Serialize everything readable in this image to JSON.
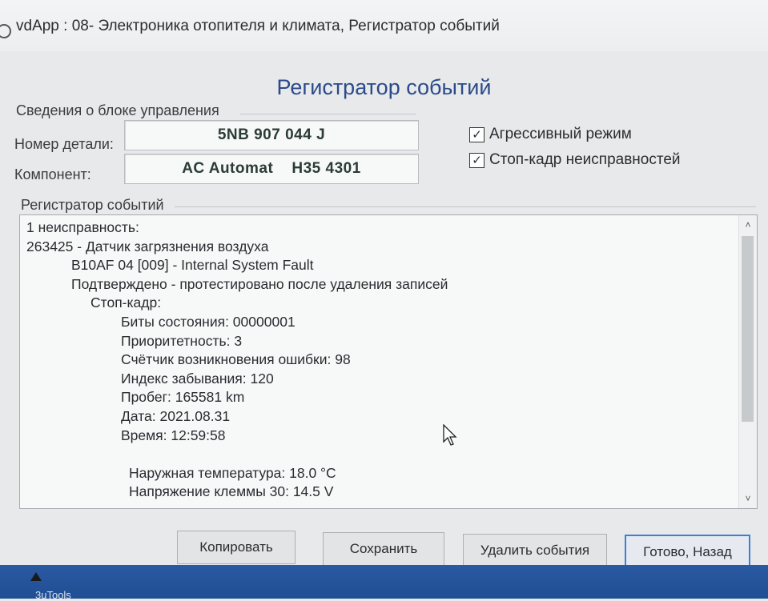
{
  "window": {
    "title": "vdApp : 08- Электроника отопителя и климата,  Регистратор событий"
  },
  "heading": "Регистратор событий",
  "module_info": {
    "section_label": "Сведения о блоке управления",
    "part_number_label": "Номер детали:",
    "part_number_value": "5NB 907 044 J",
    "component_label": "Компонент:",
    "component_value": "AC Automat    H35 4301"
  },
  "options": {
    "aggressive_mode": {
      "label": "Агрессивный режим",
      "checked": true
    },
    "freeze_frame": {
      "label": "Стоп-кадр неисправностей",
      "checked": true
    }
  },
  "event_log": {
    "section_label": "Регистратор событий",
    "lines": [
      {
        "indent": 0,
        "text": "1 неисправность:"
      },
      {
        "indent": 0,
        "text": "263425 - Датчик загрязнения воздуха"
      },
      {
        "indent": 1,
        "text": "B10AF 04 [009] - Internal System Fault"
      },
      {
        "indent": 1,
        "text": "Подтверждено - протестировано после удаления записей"
      },
      {
        "indent": 2,
        "text": "Стоп-кадр:"
      },
      {
        "indent": 3,
        "text": "Биты состояния: 00000001"
      },
      {
        "indent": 3,
        "text": "Приоритетность: 3"
      },
      {
        "indent": 3,
        "text": "Счётчик возникновения ошибки: 98"
      },
      {
        "indent": 3,
        "text": "Индекс забывания: 120"
      },
      {
        "indent": 3,
        "text": "Пробег: 165581 km"
      },
      {
        "indent": 3,
        "text": "Дата: 2021.08.31"
      },
      {
        "indent": 3,
        "text": "Время: 12:59:58"
      },
      {
        "indent": 3,
        "text": ""
      },
      {
        "indent": 3,
        "text": "Наружная температура: 18.0 °C"
      },
      {
        "indent": 3,
        "text": "Напряжение клеммы 30: 14.5 V"
      }
    ]
  },
  "buttons": {
    "copy": "Копировать",
    "save": "Сохранить",
    "delete_events": "Удалить события",
    "done_back": "Готово, Назад"
  },
  "taskbar": {
    "item_label": "3uTools"
  }
}
